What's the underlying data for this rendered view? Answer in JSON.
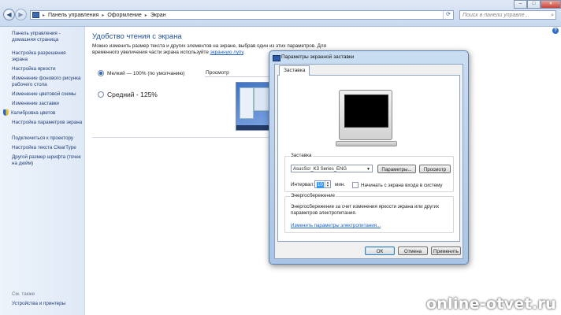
{
  "address_bar": {
    "crumbs": [
      "Панель управления",
      "Оформление",
      "Экран"
    ],
    "search_placeholder": "Поиск в панели управле...",
    "window_buttons": [
      "–",
      "□",
      "×"
    ]
  },
  "sidebar": {
    "home": "Панель управления - домашняя страница",
    "items": [
      "Настройка разрешения экрана",
      "Настройка яркости",
      "Изменение фонового рисунка рабочего стола",
      "Изменение цветовой схемы",
      "Изменение заставки",
      "Калибровка цветов",
      "Настройка параметров экрана",
      "Подключиться к проектору",
      "Настройка текста ClearType",
      "Другой размер шрифта (точек на дюйм)"
    ],
    "see_also": "См. также",
    "see_also_items": [
      "Устройства и принтеры"
    ]
  },
  "main": {
    "title": "Удобство чтения с экрана",
    "description": "Можно изменить размер текста и других элементов на экране, выбрав один из этих параметров. Для временного увеличения части экрана используйте",
    "link": "экранную лупу",
    "link_suffix": ".",
    "options": [
      {
        "label": "Мелкий — 100% (по умолчанию)",
        "checked": true
      },
      {
        "label": "Средний - 125%",
        "checked": false
      }
    ],
    "preview_label": "Просмотр"
  },
  "dialog": {
    "title": "Параметры экранной заставки",
    "tab": "Заставка",
    "screensaver_group": "Заставка",
    "screensaver_value": "AsusScr_K3 Series_ENG",
    "params_button": "Параметры...",
    "preview_button": "Просмотр",
    "interval_label": "Интервал:",
    "interval_value": "10",
    "interval_unit": "мин.",
    "resume_checkbox": "Начинать с экрана входа в систему",
    "energy_group": "Энергосбережение",
    "energy_text": "Энергосбережение за счет изменения яркости экрана или других параметров электропитания.",
    "energy_link": "Изменить параметры электропитания...",
    "ok": "ОК",
    "cancel": "Отмена",
    "apply": "Применить"
  },
  "watermark": "online-otvet.ru"
}
